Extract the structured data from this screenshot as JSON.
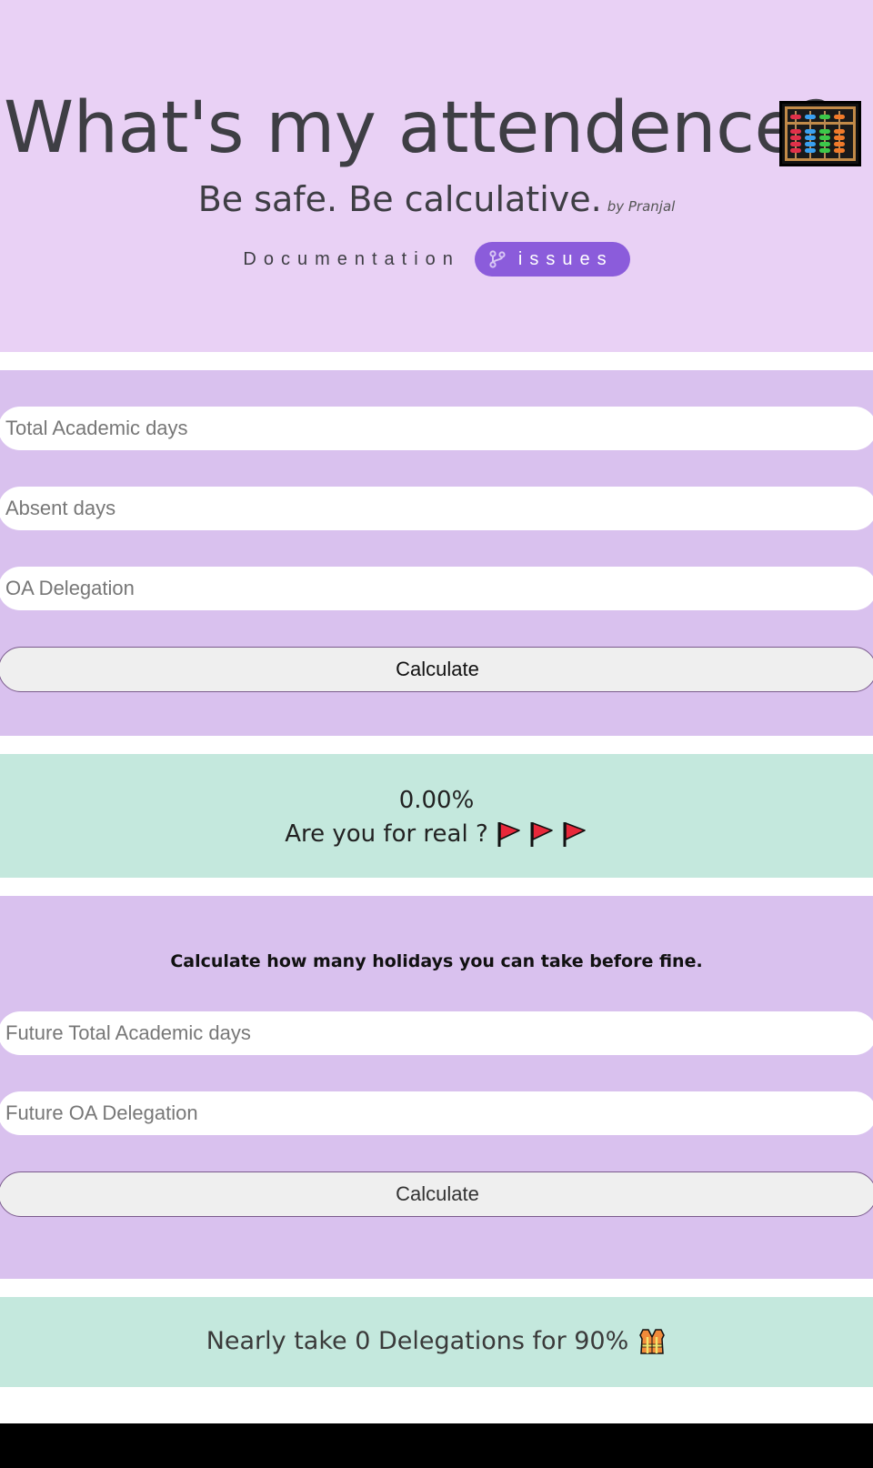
{
  "hero": {
    "title": "What's my attendence?",
    "title_icon": "abacus-icon",
    "subtitle": "Be safe. Be calculative.",
    "byline": "by Pranjal",
    "links": {
      "documentation": "Documentation",
      "issues": "issues",
      "issues_icon": "git-branch-icon"
    }
  },
  "calculator": {
    "total_days_placeholder": "Total Academic days",
    "absent_days_placeholder": "Absent days",
    "oa_delegation_placeholder": "OA Delegation",
    "calculate_label": "Calculate"
  },
  "result": {
    "percentage": "0.00%",
    "message": "Are you for real ?",
    "icon": "red-flag-icon",
    "icon_count": 3
  },
  "future": {
    "heading": "Calculate how many holidays you can take before fine.",
    "future_total_days_placeholder": "Future Total Academic days",
    "future_oa_delegation_placeholder": "Future OA Delegation",
    "calculate_label": "Calculate"
  },
  "future_result": {
    "message": "Nearly take 0 Delegations for 90%",
    "icon": "safety-vest-icon"
  },
  "colors": {
    "hero_bg": "#e9d1f5",
    "panel_bg": "#d9c1ee",
    "result_bg": "#c4e8dd",
    "accent": "#8b5cdb",
    "footer_bg": "#000000"
  }
}
